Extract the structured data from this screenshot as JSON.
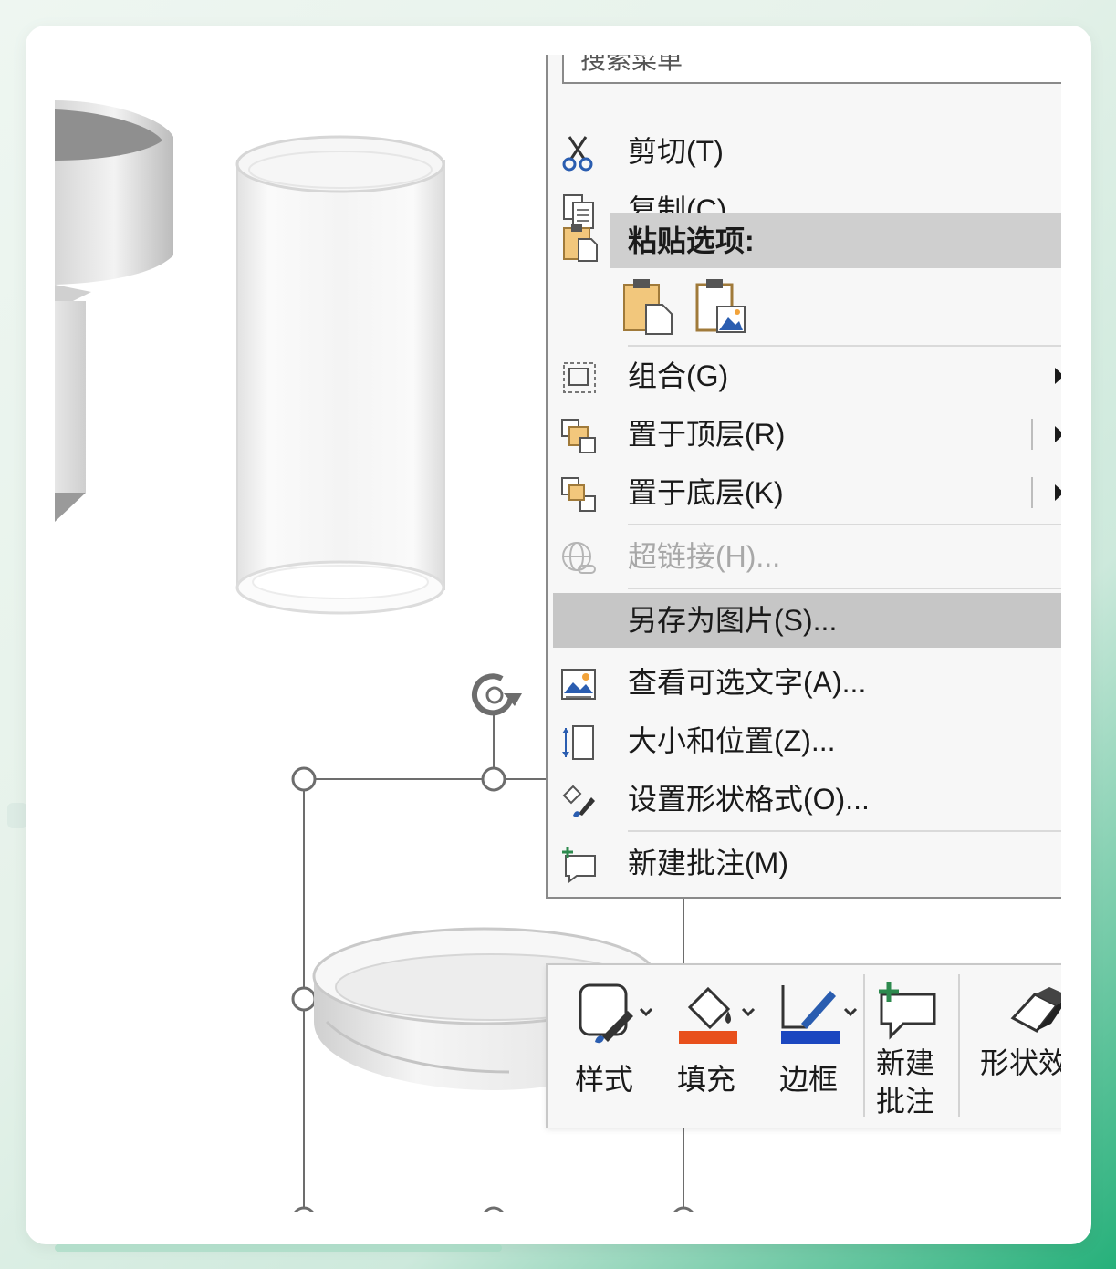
{
  "menu": {
    "search_placeholder": "搜索菜单",
    "items": {
      "cut": "剪切(T)",
      "copy": "复制(C)",
      "paste_options": "粘贴选项:",
      "group": "组合(G)",
      "bring_to_front": "置于顶层(R)",
      "send_to_back": "置于底层(K)",
      "hyperlink": "超链接(H)...",
      "save_as_picture": "另存为图片(S)...",
      "view_alt_text": "查看可选文字(A)...",
      "size_position": "大小和位置(Z)...",
      "format_shape": "设置形状格式(O)...",
      "new_comment": "新建批注(M)"
    }
  },
  "toolbar": {
    "style": "样式",
    "fill": "填充",
    "border": "边框",
    "new_comment_line1": "新建",
    "new_comment_line2": "批注",
    "shape_effects": "形状效果"
  },
  "colors": {
    "fill_accent": "#e8501c",
    "border_accent": "#1b47c0",
    "highlight": "#c6c6c6"
  }
}
